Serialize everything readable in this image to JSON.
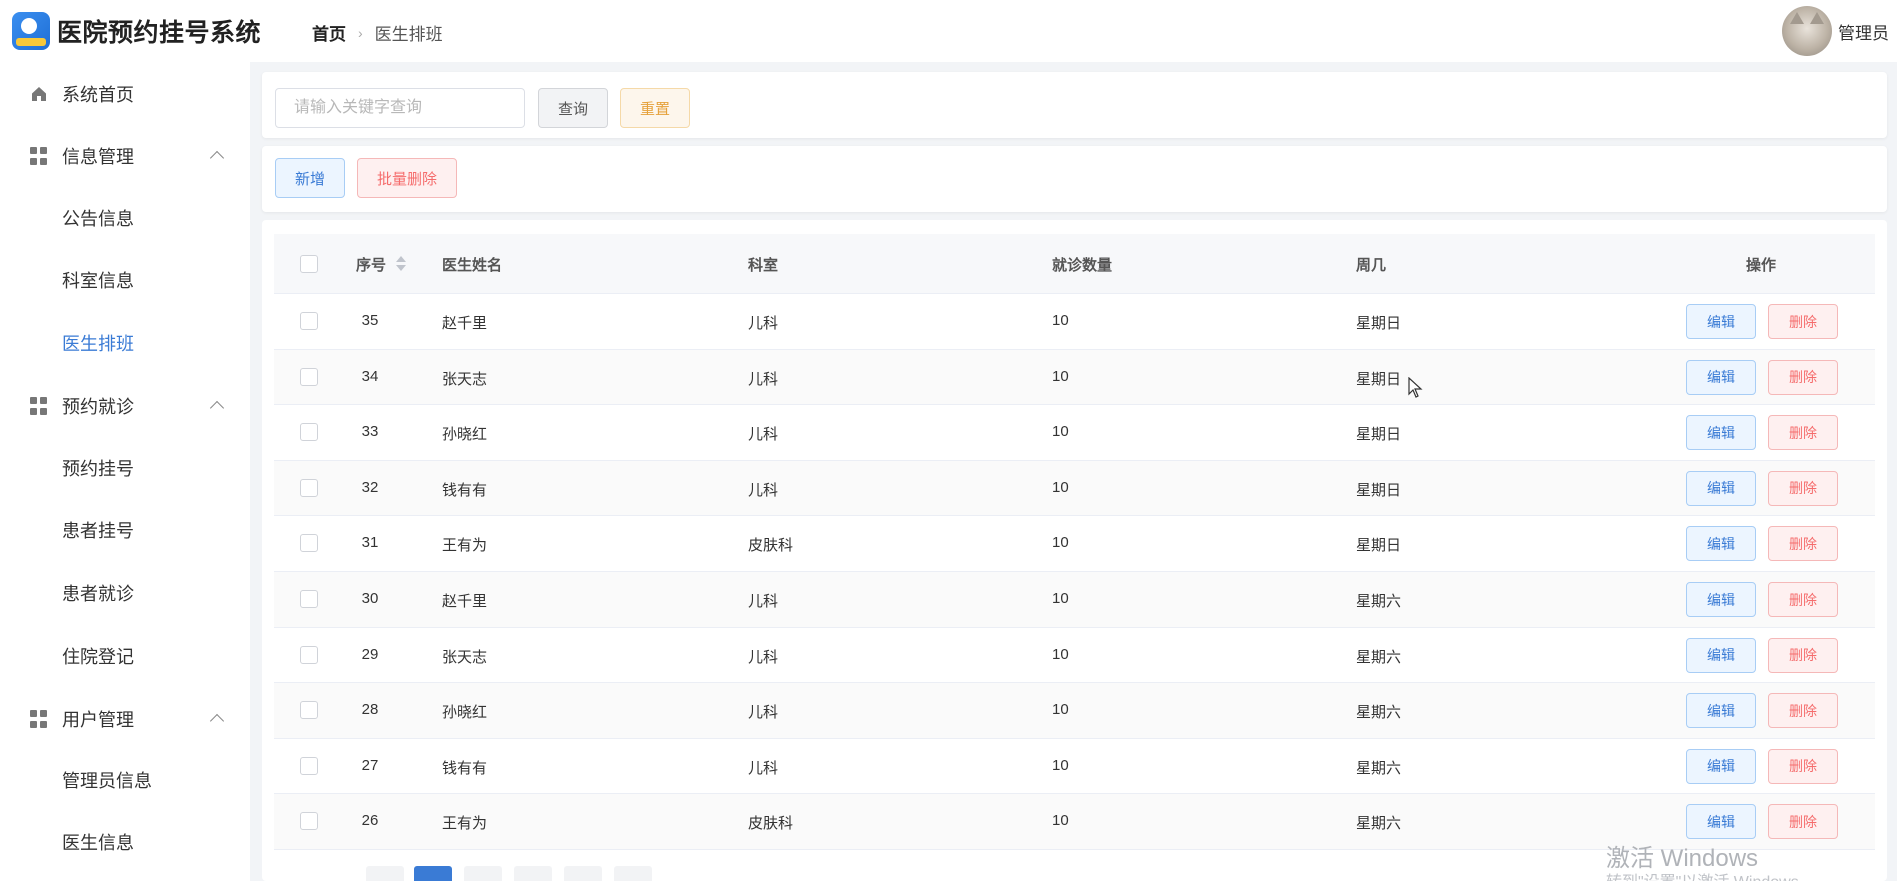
{
  "header": {
    "app_title": "医院预约挂号系统",
    "breadcrumb_home": "首页",
    "breadcrumb_sep": "›",
    "breadcrumb_current": "医生排班",
    "user_name": "管理员"
  },
  "sidebar": {
    "items": [
      {
        "label": "系统首页",
        "icon": "home-icon",
        "type": "item"
      },
      {
        "label": "信息管理",
        "icon": "grid-icon",
        "type": "group",
        "expanded": true
      },
      {
        "label": "公告信息",
        "type": "sub"
      },
      {
        "label": "科室信息",
        "type": "sub"
      },
      {
        "label": "医生排班",
        "type": "sub",
        "active": true
      },
      {
        "label": "预约就诊",
        "icon": "grid-icon",
        "type": "group",
        "expanded": true
      },
      {
        "label": "预约挂号",
        "type": "sub"
      },
      {
        "label": "患者挂号",
        "type": "sub"
      },
      {
        "label": "患者就诊",
        "type": "sub"
      },
      {
        "label": "住院登记",
        "type": "sub"
      },
      {
        "label": "用户管理",
        "icon": "grid-icon",
        "type": "group",
        "expanded": true
      },
      {
        "label": "管理员信息",
        "type": "sub"
      },
      {
        "label": "医生信息",
        "type": "sub"
      }
    ]
  },
  "search": {
    "placeholder": "请输入关键字查询",
    "query_label": "查询",
    "reset_label": "重置"
  },
  "actions": {
    "add_label": "新增",
    "batch_delete_label": "批量删除"
  },
  "table": {
    "headers": {
      "id": "序号",
      "doctor": "医生姓名",
      "department": "科室",
      "count": "就诊数量",
      "weekday": "周几",
      "ops": "操作"
    },
    "edit_label": "编辑",
    "delete_label": "删除",
    "rows": [
      {
        "id": "35",
        "doctor": "赵千里",
        "department": "儿科",
        "count": "10",
        "weekday": "星期日"
      },
      {
        "id": "34",
        "doctor": "张天志",
        "department": "儿科",
        "count": "10",
        "weekday": "星期日"
      },
      {
        "id": "33",
        "doctor": "孙晓红",
        "department": "儿科",
        "count": "10",
        "weekday": "星期日"
      },
      {
        "id": "32",
        "doctor": "钱有有",
        "department": "儿科",
        "count": "10",
        "weekday": "星期日"
      },
      {
        "id": "31",
        "doctor": "王有为",
        "department": "皮肤科",
        "count": "10",
        "weekday": "星期日"
      },
      {
        "id": "30",
        "doctor": "赵千里",
        "department": "儿科",
        "count": "10",
        "weekday": "星期六"
      },
      {
        "id": "29",
        "doctor": "张天志",
        "department": "儿科",
        "count": "10",
        "weekday": "星期六"
      },
      {
        "id": "28",
        "doctor": "孙晓红",
        "department": "儿科",
        "count": "10",
        "weekday": "星期六"
      },
      {
        "id": "27",
        "doctor": "钱有有",
        "department": "儿科",
        "count": "10",
        "weekday": "星期六"
      },
      {
        "id": "26",
        "doctor": "王有为",
        "department": "皮肤科",
        "count": "10",
        "weekday": "星期六"
      }
    ]
  },
  "watermark": {
    "line1": "激活 Windows",
    "line2": "转到\"设置\"以激活 Windows。"
  }
}
